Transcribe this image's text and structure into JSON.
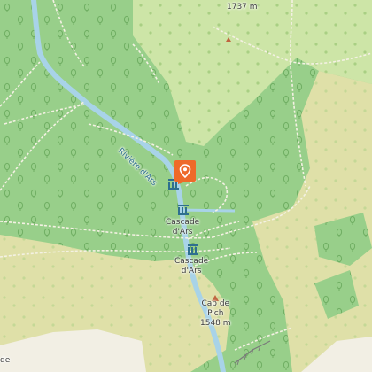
{
  "map": {
    "colors": {
      "forest": "#98cf8a",
      "grassland": "#cbe7a6",
      "scrub": "#cde5a7",
      "meadow": "#dfe0a8",
      "bare": "#f2efe4",
      "river": "#a8d3e8",
      "marker": "#ee6a29"
    },
    "labels": {
      "peak_top": "1737 m",
      "river": "Rivière d'Ars",
      "cascade_1": "Cascade\nd'Ars",
      "cascade_2": "Cascade\nd'Ars",
      "peak_bottom": "Cap de\nPich\n1548 m",
      "edge_left": "de"
    },
    "icons": {
      "location_marker": "map-pin-icon",
      "waterfall": "waterfall-icon",
      "peak": "peak-triangle-icon"
    }
  }
}
